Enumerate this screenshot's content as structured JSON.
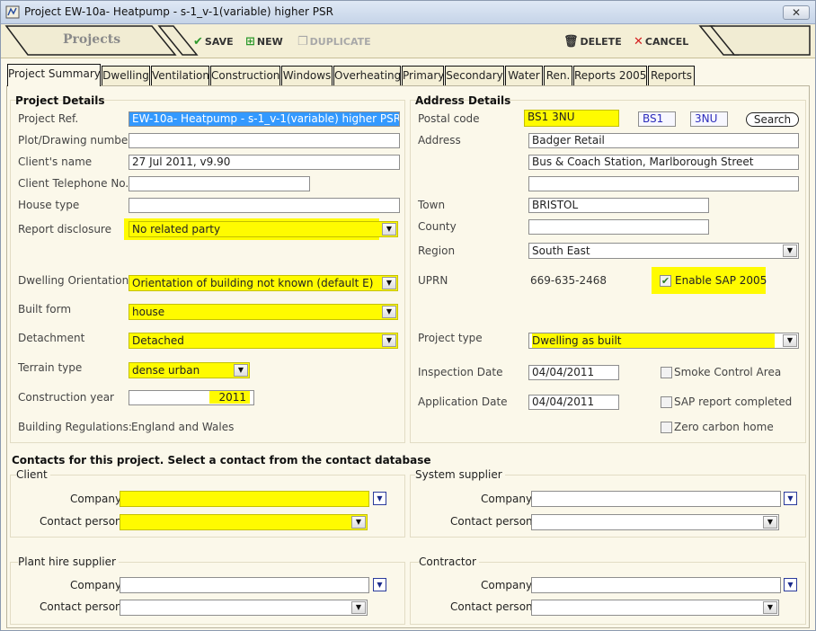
{
  "window": {
    "title": "Project EW-10a- Heatpump - s-1_v-1(variable) higher PSR",
    "close_label": "✕"
  },
  "toolbar": {
    "section_label": "Projects",
    "save_label": "SAVE",
    "new_label": "NEW",
    "duplicate_label": "DUPLICATE",
    "delete_label": "DELETE",
    "cancel_label": "CANCEL"
  },
  "tabs": [
    {
      "label": "Project Summary"
    },
    {
      "label": "Dwelling"
    },
    {
      "label": "Ventilation"
    },
    {
      "label": "Construction"
    },
    {
      "label": "Windows"
    },
    {
      "label": "Overheating"
    },
    {
      "label": "Primary"
    },
    {
      "label": "Secondary"
    },
    {
      "label": "Water"
    },
    {
      "label": "Ren."
    },
    {
      "label": "Reports 2005"
    },
    {
      "label": "Reports"
    }
  ],
  "project": {
    "heading": "Project Details",
    "ref_label": "Project Ref.",
    "ref_value": "EW-10a- Heatpump - s-1_v-1(variable) higher PSR",
    "plot_label": "Plot/Drawing number",
    "plot_value": "",
    "client_label": "Client's name",
    "client_value": "27 Jul 2011, v9.90",
    "phone_label": "Client Telephone No.",
    "phone_value": "",
    "house_type_label": "House type",
    "house_type_value": "",
    "disclosure_label": "Report disclosure",
    "disclosure_value": "No related party",
    "orientation_label": "Dwelling Orientation",
    "orientation_value": "Orientation of building not known (default E)",
    "built_form_label": "Built form",
    "built_form_value": "house",
    "detachment_label": "Detachment",
    "detachment_value": "Detached",
    "terrain_label": "Terrain type",
    "terrain_value": "dense urban",
    "year_label": "Construction year",
    "year_value": "2011",
    "regs_label": "Building Regulations:",
    "regs_value": "England and Wales"
  },
  "address": {
    "heading": "Address Details",
    "postal_label": "Postal code",
    "postal_value": "BS1 3NU",
    "postal_part1": "BS1",
    "postal_part2": "3NU",
    "search_label": "Search",
    "address_label": "Address",
    "line1": "Badger Retail",
    "line2": "Bus & Coach Station, Marlborough Street",
    "line3": "",
    "town_label": "Town",
    "town_value": "BRISTOL",
    "county_label": "County",
    "county_value": "",
    "region_label": "Region",
    "region_value": "South East",
    "uprn_label": "UPRN",
    "uprn_value": "669-635-2468",
    "sap2005_label": "Enable SAP 2005",
    "sap2005_checked": true,
    "project_type_label": "Project type",
    "project_type_value": "Dwelling as built",
    "inspection_label": "Inspection Date",
    "inspection_value": "04/04/2011",
    "application_label": "Application Date",
    "application_value": "04/04/2011",
    "smoke_label": "Smoke Control Area",
    "sap_report_label": "SAP report completed",
    "zero_carbon_label": "Zero carbon home"
  },
  "contacts": {
    "heading": "Contacts for this project. Select a contact from the contact database",
    "company_label": "Company",
    "person_label": "Contact person",
    "client_title": "Client",
    "supplier_title": "System supplier",
    "plant_title": "Plant hire supplier",
    "contractor_title": "Contractor"
  },
  "colors": {
    "highlight": "#fffb00",
    "panel": "#fbf8ea",
    "toolbar": "#f4efd6",
    "save_check": "#2e9a2e",
    "cancel_x": "#d42020"
  }
}
